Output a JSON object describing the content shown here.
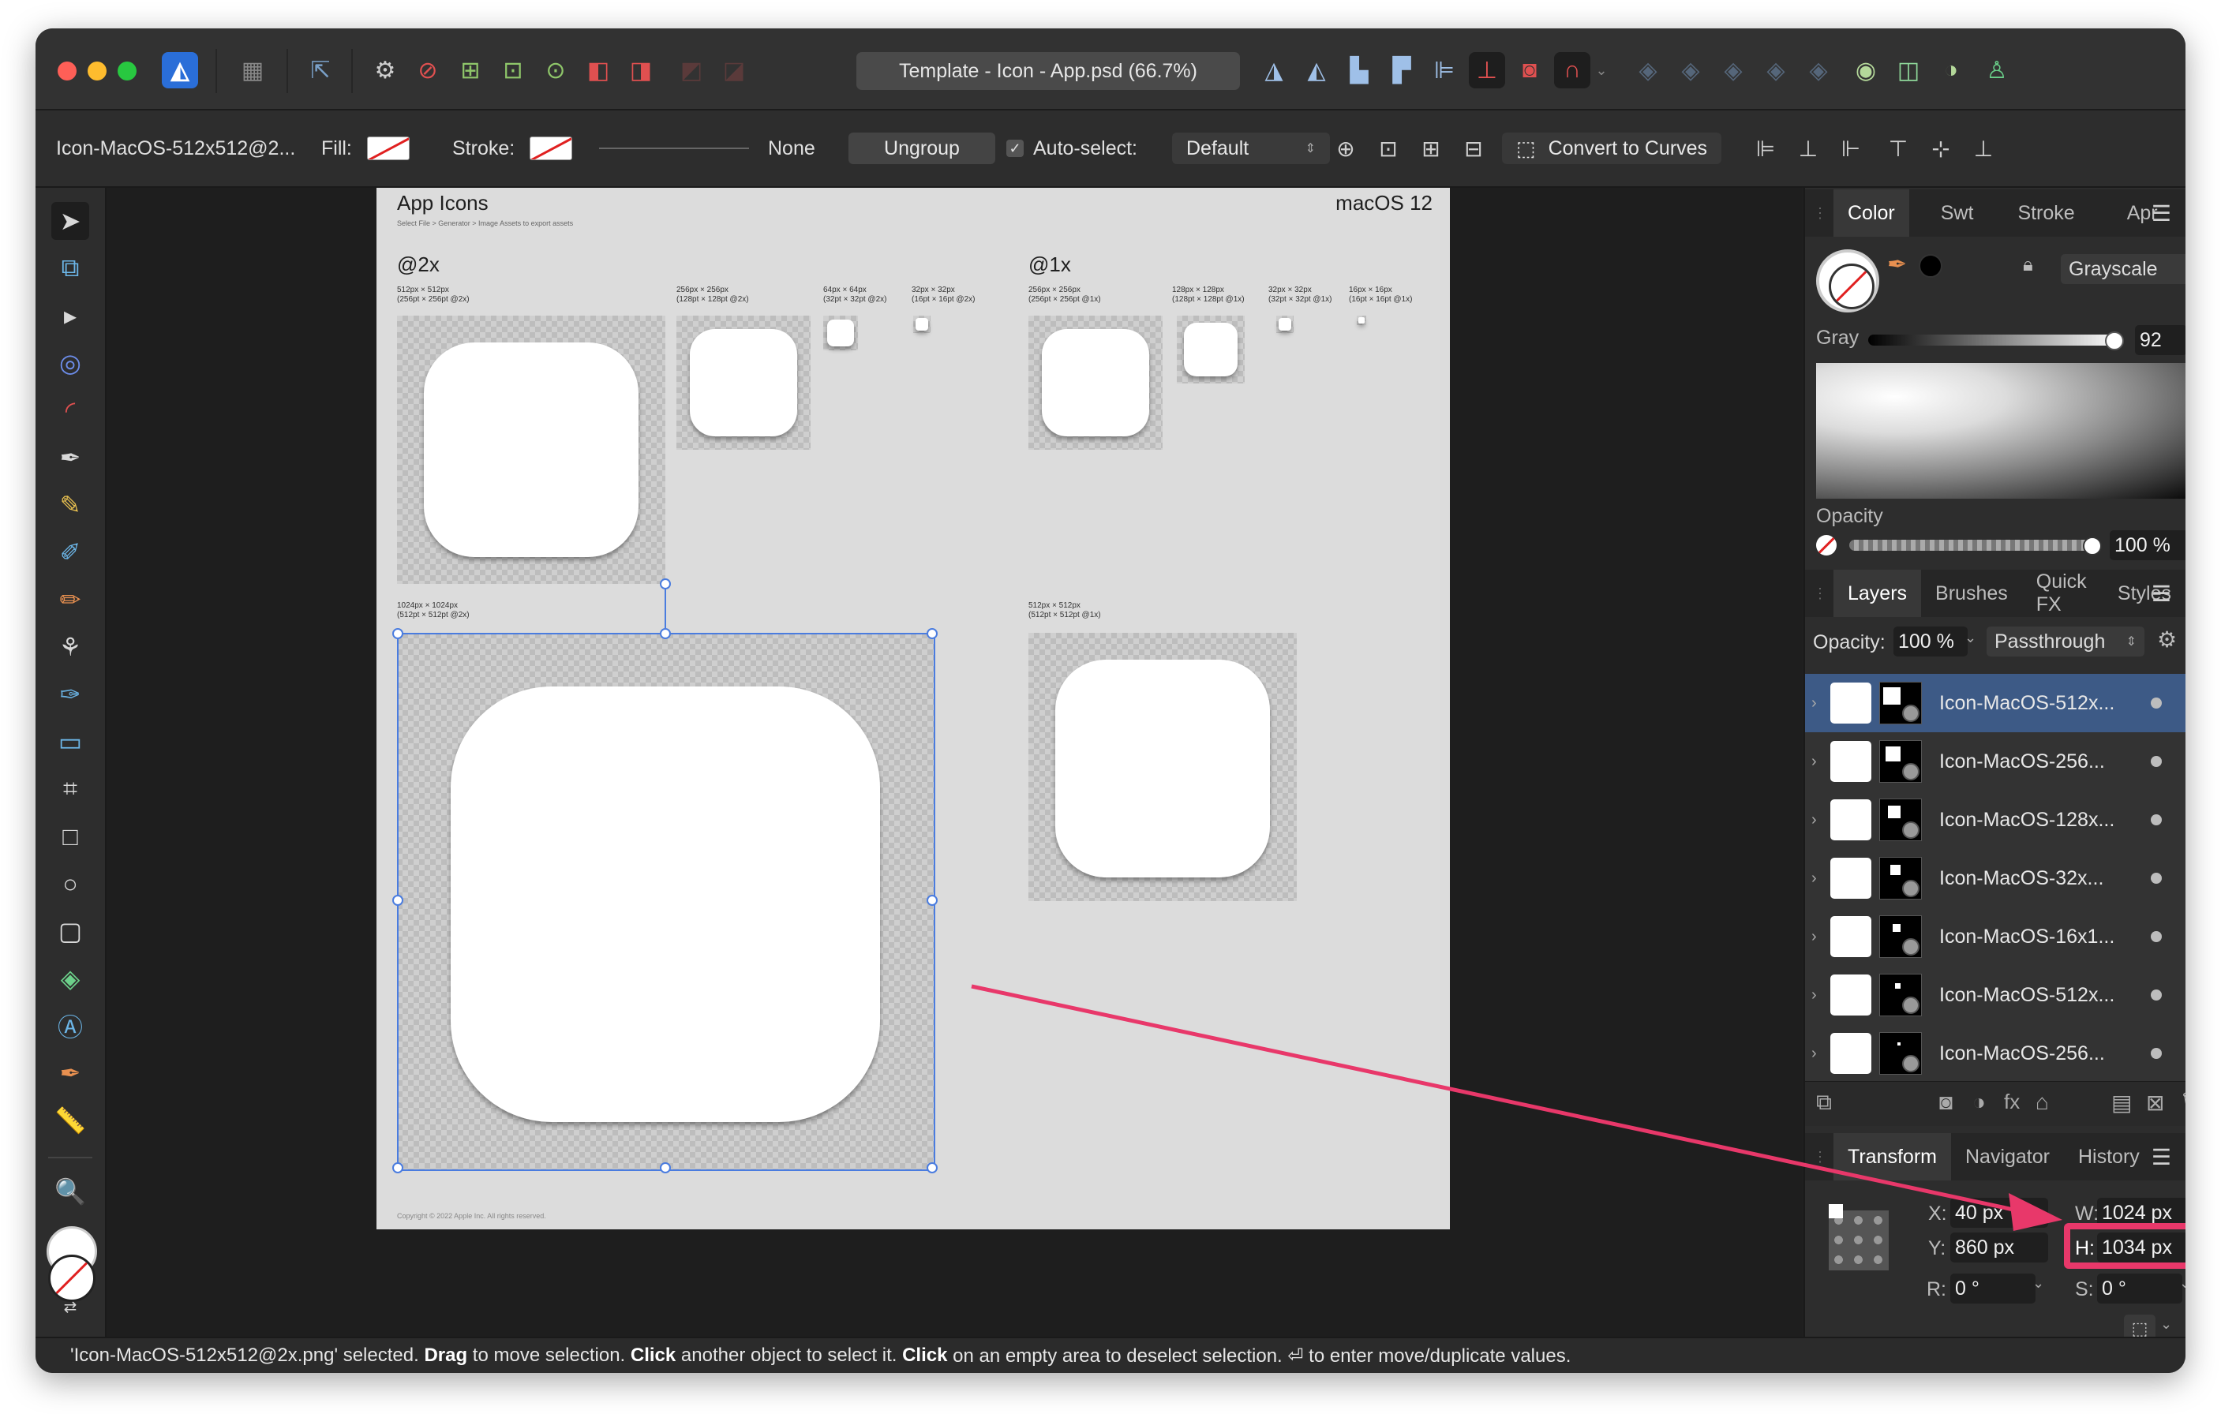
{
  "window": {
    "title": "Template - Icon - App.psd (66.7%)"
  },
  "context_toolbar": {
    "layer_name": "Icon-MacOS-512x512@2...",
    "fill_label": "Fill:",
    "stroke_label": "Stroke:",
    "stroke_value": "None",
    "ungroup_label": "Ungroup",
    "auto_select_label": "Auto-select:",
    "auto_select_value": "Default",
    "convert_label": "Convert to Curves"
  },
  "document": {
    "title": "App Icons",
    "subtitle": "Select File > Generator > Image Assets to export assets",
    "platform": "macOS 12",
    "section_2x": "@2x",
    "section_1x": "@1x",
    "labels": {
      "l512_2x": [
        "512px × 512px",
        "(256pt × 256pt @2x)"
      ],
      "l256_2x": [
        "256px × 256px",
        "(128pt × 128pt @2x)"
      ],
      "l64_2x": [
        "64px × 64px",
        "(32pt × 32pt @2x)"
      ],
      "l32_2x": [
        "32px × 32px",
        "(16pt × 16pt @2x)"
      ],
      "l1024_2x": [
        "1024px × 1024px",
        "(512pt × 512pt @2x)"
      ],
      "l256_1x": [
        "256px × 256px",
        "(256pt × 256pt @1x)"
      ],
      "l128_1x": [
        "128px × 128px",
        "(128pt × 128pt @1x)"
      ],
      "l32_1x": [
        "32px × 32px",
        "(32pt × 32pt @1x)"
      ],
      "l16_1x": [
        "16px × 16px",
        "(16pt × 16pt @1x)"
      ],
      "l512_1x": [
        "512px × 512px",
        "(512pt × 512pt @1x)"
      ]
    },
    "copyright": "Copyright © 2022 Apple Inc. All rights reserved."
  },
  "color_panel": {
    "tabs": [
      "Color",
      "Swt",
      "Stroke",
      "Apr"
    ],
    "mode": "Grayscale",
    "gray_label": "Gray",
    "gray_value": "92",
    "opacity_label": "Opacity",
    "opacity_value": "100 %"
  },
  "layers_panel": {
    "tabs": [
      "Layers",
      "Brushes",
      "Quick FX",
      "Styles"
    ],
    "opacity_label": "Opacity:",
    "opacity_value": "100 %",
    "blend_mode": "Passthrough",
    "layers": [
      "Icon-MacOS-512x...",
      "Icon-MacOS-256...",
      "Icon-MacOS-128x...",
      "Icon-MacOS-32x...",
      "Icon-MacOS-16x1...",
      "Icon-MacOS-512x...",
      "Icon-MacOS-256..."
    ]
  },
  "transform_panel": {
    "tabs": [
      "Transform",
      "Navigator",
      "History"
    ],
    "x_label": "X:",
    "x_value": "40 px",
    "y_label": "Y:",
    "y_value": "860 px",
    "w_label": "W:",
    "w_value": "1024 px",
    "h_label": "H:",
    "h_value": "1034 px",
    "r_label": "R:",
    "r_value": "0 °",
    "s_label": "S:",
    "s_value": "0 °"
  },
  "status_bar": {
    "part1": "'Icon-MacOS-512x512@2x.png' selected. ",
    "drag": "Drag",
    "part2": " to move selection. ",
    "click1": "Click",
    "part3": " another object to select it. ",
    "click2": "Click",
    "part4": " on an empty area to deselect selection. ⏎ to enter move/duplicate values."
  },
  "annotation": {
    "color": "#e8386a"
  },
  "colors": {
    "accent": "#4a7cdf",
    "selection_row": "#3d5a86",
    "traffic_red": "#fe5f57",
    "traffic_yellow": "#febc2e",
    "traffic_green": "#28c840"
  }
}
